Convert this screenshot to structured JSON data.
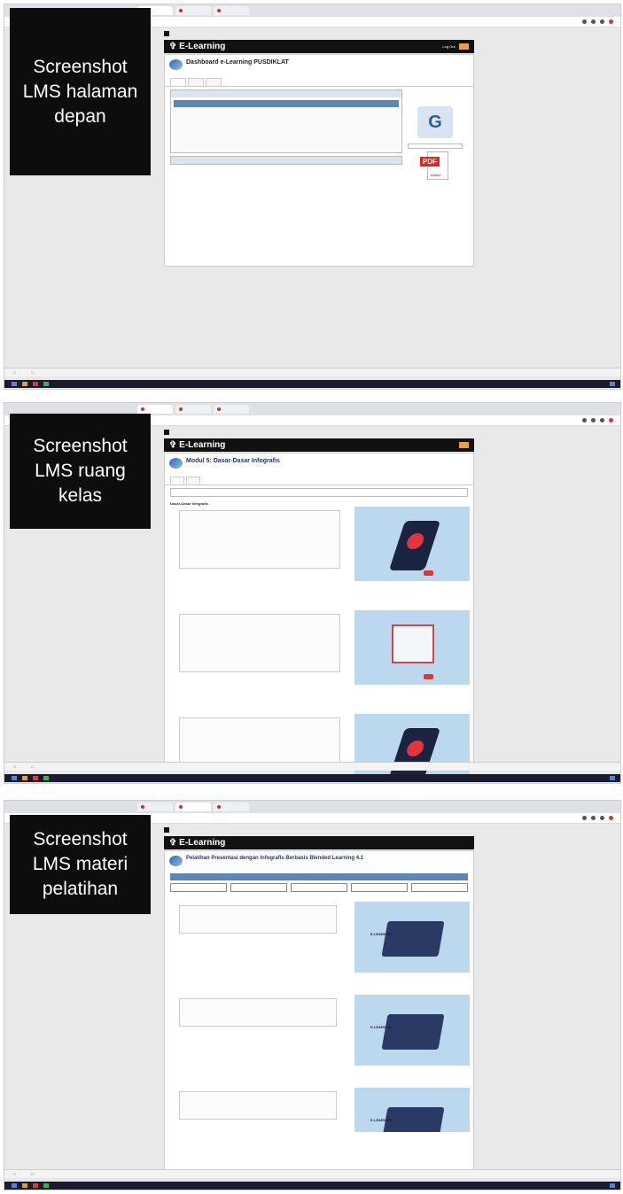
{
  "shots": [
    {
      "label": "Screenshot LMS halaman depan",
      "nav": {
        "brand": "E-Learning",
        "login": "Log Out"
      },
      "title": "Dashboard e-Learning PUSDIKLAT",
      "tabs": [
        "",
        "",
        ""
      ],
      "panel1": "",
      "panel2": "",
      "side_caption": "",
      "pdf": {
        "tag": "PDF",
        "brand": "Adobe"
      }
    },
    {
      "label": "Screenshot LMS ruang kelas",
      "nav": {
        "brand": "E-Learning"
      },
      "title": "Modul 5: Dasar-Dasar Infografis",
      "sections": [
        "Dasar-Dasar Infografis",
        "",
        ""
      ]
    },
    {
      "label": "Screenshot LMS materi pelatihan",
      "nav": {
        "brand": "E-Learning"
      },
      "title": "Pelatihan Presentasi dengan Infografis Berbasis Blended Learning 4.1",
      "materials": [
        {
          "el": "E-LEARNING"
        },
        {
          "el": "E-LEARNING"
        },
        {
          "el": "E-LEARNING"
        }
      ]
    }
  ]
}
